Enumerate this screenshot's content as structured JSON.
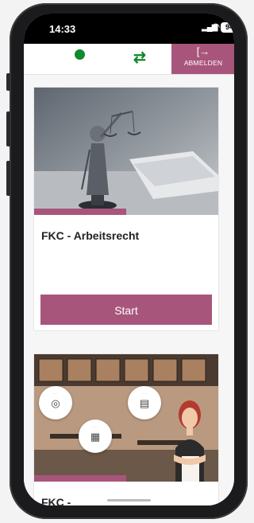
{
  "statusbar": {
    "time": "14:33",
    "battery": "94"
  },
  "header": {
    "sync_icon": "⇄",
    "logout_icon": "[→",
    "logout_label": "ABMELDEN"
  },
  "courses": [
    {
      "title": "FKC - Arbeitsrecht",
      "button_label": "Start",
      "image": "justitia-statue-icon"
    },
    {
      "title": "FKC -",
      "image": "office-illustration-icon"
    }
  ],
  "colors": {
    "accent": "#a8557b",
    "status_online": "#0f8a2c",
    "sync": "#10852a"
  }
}
